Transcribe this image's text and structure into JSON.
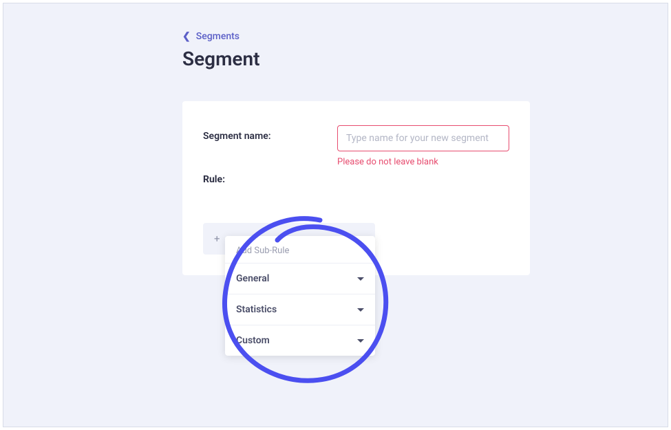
{
  "breadcrumb": {
    "label": "Segments"
  },
  "page_title": "Segment",
  "form": {
    "segment_name_label": "Segment name:",
    "segment_name_placeholder": "Type name for your new segment",
    "segment_name_value": "",
    "segment_name_error": "Please do not leave blank",
    "rule_label": "Rule:"
  },
  "add_rule": {
    "plus": "+"
  },
  "dropdown": {
    "header": "Add Sub-Rule",
    "items": [
      {
        "label": "General"
      },
      {
        "label": "Statistics"
      },
      {
        "label": "Custom"
      }
    ]
  }
}
